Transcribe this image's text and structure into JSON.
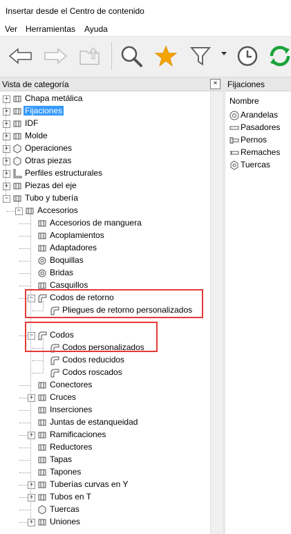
{
  "window": {
    "title": "Insertar desde el Centro de contenido"
  },
  "menu": [
    "Ver",
    "Herramientas",
    "Ayuda"
  ],
  "toolbar": [
    {
      "name": "back-button",
      "icon": "arrow-left-icon"
    },
    {
      "name": "forward-button",
      "icon": "arrow-right-icon"
    },
    {
      "name": "up-level-button",
      "icon": "folder-up-icon"
    },
    {
      "name": "search-button",
      "icon": "magnifier-icon"
    },
    {
      "name": "favorites-button",
      "icon": "star-icon"
    },
    {
      "name": "filter-button",
      "icon": "funnel-icon"
    },
    {
      "name": "history-button",
      "icon": "clock-icon"
    },
    {
      "name": "refresh-button",
      "icon": "refresh-icon"
    }
  ],
  "left_panel": {
    "title": "Vista de categoría",
    "close": "×"
  },
  "tree": [
    {
      "label": "Chapa metálica",
      "level": 0,
      "expander": "+"
    },
    {
      "label": "Fijaciones",
      "level": 0,
      "expander": "+",
      "selected": true
    },
    {
      "label": "IDF",
      "level": 0,
      "expander": "+"
    },
    {
      "label": "Molde",
      "level": 0,
      "expander": "+"
    },
    {
      "label": "Operaciones",
      "level": 0,
      "expander": "+"
    },
    {
      "label": "Otras piezas",
      "level": 0,
      "expander": "+"
    },
    {
      "label": "Perfiles estructurales",
      "level": 0,
      "expander": "+"
    },
    {
      "label": "Piezas del eje",
      "level": 0,
      "expander": "+"
    },
    {
      "label": "Tubo y tubería",
      "level": 0,
      "expander": "−"
    },
    {
      "label": "Accesorios",
      "level": 1,
      "expander": "−"
    },
    {
      "label": "Accesorios de manguera",
      "level": 2
    },
    {
      "label": "Acoplamientos",
      "level": 2
    },
    {
      "label": "Adaptadores",
      "level": 2
    },
    {
      "label": "Boquillas",
      "level": 2
    },
    {
      "label": "Bridas",
      "level": 2
    },
    {
      "label": "Casquillos",
      "level": 2
    },
    {
      "label": "Codos de retorno",
      "level": 2,
      "expander": "−"
    },
    {
      "label": "Pliegues de retorno personalizados",
      "level": 3
    },
    {
      "label": "",
      "level": 2,
      "spacer": true
    },
    {
      "label": "Codos",
      "level": 2,
      "expander": "−"
    },
    {
      "label": "Codos personalizados",
      "level": 3
    },
    {
      "label": "Codos reducidos",
      "level": 3
    },
    {
      "label": "Codos roscados",
      "level": 3
    },
    {
      "label": "Conectores",
      "level": 2
    },
    {
      "label": "Cruces",
      "level": 2,
      "expander": "+"
    },
    {
      "label": "Inserciones",
      "level": 2
    },
    {
      "label": "Juntas de estanqueidad",
      "level": 2
    },
    {
      "label": "Ramificaciones",
      "level": 2,
      "expander": "+"
    },
    {
      "label": "Reductores",
      "level": 2
    },
    {
      "label": "Tapas",
      "level": 2
    },
    {
      "label": "Tapones",
      "level": 2
    },
    {
      "label": "Tuberías curvas en Y",
      "level": 2,
      "expander": "+"
    },
    {
      "label": "Tubos en T",
      "level": 2,
      "expander": "+"
    },
    {
      "label": "Tuercas",
      "level": 2
    },
    {
      "label": "Uniones",
      "level": 2,
      "expander": "+"
    }
  ],
  "right_panel": {
    "title": "Fijaciones",
    "column": "Nombre",
    "items": [
      {
        "label": "Arandelas",
        "icon": "washer-icon"
      },
      {
        "label": "Pasadores",
        "icon": "pin-icon"
      },
      {
        "label": "Pernos",
        "icon": "bolt-icon"
      },
      {
        "label": "Remaches",
        "icon": "rivet-icon"
      },
      {
        "label": "Tuercas",
        "icon": "nut-icon"
      }
    ]
  },
  "colors": {
    "selection": "#3399ff",
    "highlight_box": "#e53935",
    "refresh_green": "#1aa33b",
    "star_orange": "#f5a300"
  }
}
